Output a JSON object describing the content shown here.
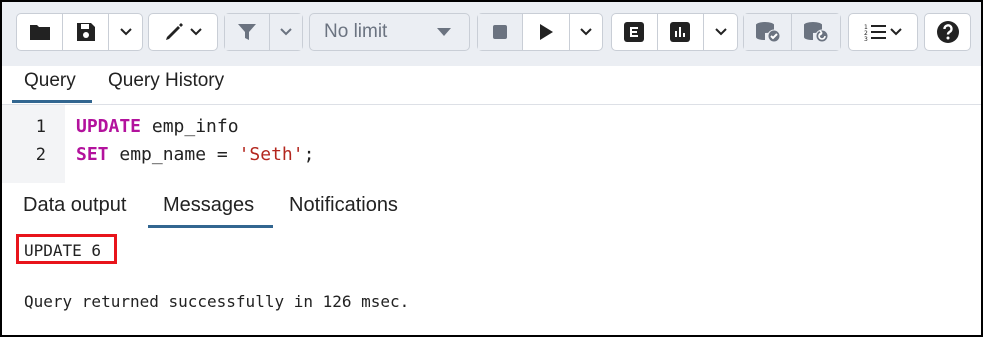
{
  "toolbar": {
    "limit_label": "No limit"
  },
  "query_tabs": [
    {
      "label": "Query"
    },
    {
      "label": "Query History"
    }
  ],
  "editor": {
    "line_numbers": [
      "1",
      "2"
    ],
    "line1": {
      "keyword": "UPDATE",
      "rest": " emp_info"
    },
    "line2": {
      "keyword": "SET",
      "rest": " emp_name = ",
      "string": "'Seth'",
      "end": ";"
    }
  },
  "result_tabs": [
    {
      "label": "Data output"
    },
    {
      "label": "Messages"
    },
    {
      "label": "Notifications"
    }
  ],
  "messages": {
    "status": "UPDATE 6",
    "detail": "Query returned successfully in 126 msec."
  },
  "colors": {
    "keyword": "#b3129d",
    "string": "#b3261e",
    "tab_underline": "#326690",
    "highlight_box": "#e8141b"
  }
}
